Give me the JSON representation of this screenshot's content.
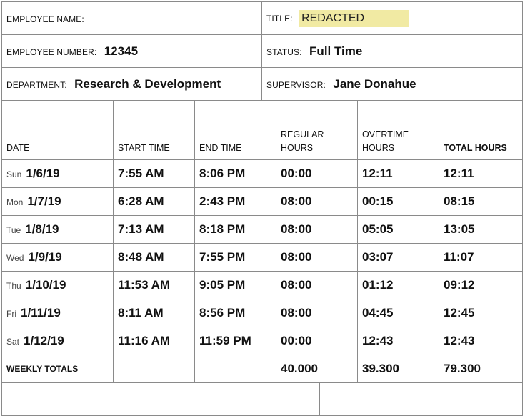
{
  "header": {
    "employee_name_label": "EMPLOYEE NAME:",
    "employee_name_value": "",
    "title_label": "TITLE:",
    "title_value": "REDACTED",
    "employee_number_label": "EMPLOYEE NUMBER:",
    "employee_number_value": "12345",
    "status_label": "STATUS:",
    "status_value": "Full Time",
    "department_label": "DEPARTMENT:",
    "department_value": "Research & Development",
    "supervisor_label": "SUPERVISOR:",
    "supervisor_value": "Jane Donahue"
  },
  "table": {
    "columns": {
      "date": "DATE",
      "start": "START TIME",
      "end": "END TIME",
      "regular_1": "REGULAR",
      "regular_2": "HOURS",
      "overtime_1": "OVERTIME",
      "overtime_2": "HOURS",
      "total": "TOTAL HOURS"
    },
    "rows": [
      {
        "day": "Sun",
        "date": "1/6/19",
        "start": "7:55 AM",
        "end": "8:06 PM",
        "regular": "00:00",
        "overtime": "12:11",
        "total": "12:11"
      },
      {
        "day": "Mon",
        "date": "1/7/19",
        "start": "6:28 AM",
        "end": "2:43 PM",
        "regular": "08:00",
        "overtime": "00:15",
        "total": "08:15"
      },
      {
        "day": "Tue",
        "date": "1/8/19",
        "start": "7:13 AM",
        "end": "8:18 PM",
        "regular": "08:00",
        "overtime": "05:05",
        "total": "13:05"
      },
      {
        "day": "Wed",
        "date": "1/9/19",
        "start": "8:48 AM",
        "end": "7:55 PM",
        "regular": "08:00",
        "overtime": "03:07",
        "total": "11:07"
      },
      {
        "day": "Thu",
        "date": "1/10/19",
        "start": "11:53 AM",
        "end": "9:05 PM",
        "regular": "08:00",
        "overtime": "01:12",
        "total": "09:12"
      },
      {
        "day": "Fri",
        "date": "1/11/19",
        "start": "8:11 AM",
        "end": "8:56 PM",
        "regular": "08:00",
        "overtime": "04:45",
        "total": "12:45"
      },
      {
        "day": "Sat",
        "date": "1/12/19",
        "start": "11:16 AM",
        "end": "11:59 PM",
        "regular": "00:00",
        "overtime": "12:43",
        "total": "12:43"
      }
    ],
    "totals": {
      "label": "WEEKLY TOTALS",
      "regular": "40.000",
      "overtime": "39.300",
      "total": "79.300"
    }
  }
}
